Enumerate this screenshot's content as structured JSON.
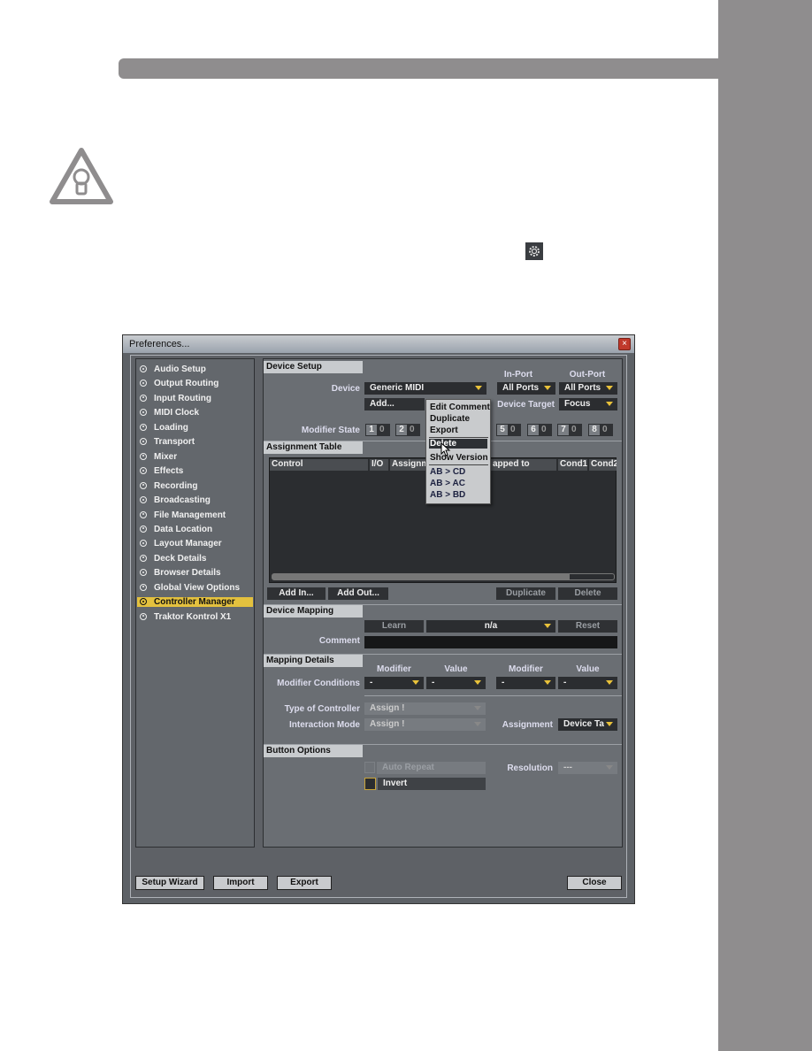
{
  "page": {
    "tip_icon": "lightbulb-warning-icon",
    "gear_icon": "gear-icon"
  },
  "dialog": {
    "title": "Preferences...",
    "nav": [
      "Audio Setup",
      "Output Routing",
      "Input Routing",
      "MIDI Clock",
      "Loading",
      "Transport",
      "Mixer",
      "Effects",
      "Recording",
      "Broadcasting",
      "File Management",
      "Data Location",
      "Layout Manager",
      "Deck Details",
      "Browser Details",
      "Global View Options",
      "Controller Manager",
      "Traktor Kontrol X1"
    ],
    "selected_nav": "Controller Manager",
    "device_setup": {
      "title": "Device Setup",
      "device_label": "Device",
      "device_value": "Generic MIDI",
      "in_port_label": "In-Port",
      "in_port_value": "All Ports",
      "out_port_label": "Out-Port",
      "out_port_value": "All Ports",
      "add_label": "Add...",
      "device_target_label": "Device Target",
      "device_target_value": "Focus",
      "modifier_state_label": "Modifier State",
      "modifiers": [
        {
          "n": "1",
          "v": "0"
        },
        {
          "n": "2",
          "v": "0"
        },
        {
          "n": "5",
          "v": "0"
        },
        {
          "n": "6",
          "v": "0"
        },
        {
          "n": "7",
          "v": "0"
        },
        {
          "n": "8",
          "v": "0"
        }
      ]
    },
    "context_menu": {
      "items": [
        "Edit Comment",
        "Duplicate",
        "Export",
        "Delete",
        "Show Version",
        "AB > CD",
        "AB > AC",
        "AB > BD"
      ],
      "highlighted": "Delete"
    },
    "assignment_table": {
      "title": "Assignment Table",
      "columns": [
        "Control",
        "I/O",
        "Assignm",
        "apped to",
        "Cond1",
        "Cond2"
      ],
      "add_in": "Add In...",
      "add_out": "Add Out...",
      "duplicate": "Duplicate",
      "delete": "Delete"
    },
    "device_mapping": {
      "title": "Device Mapping",
      "learn": "Learn",
      "value": "n/a",
      "reset": "Reset",
      "comment_label": "Comment",
      "comment_value": ""
    },
    "mapping_details": {
      "title": "Mapping Details",
      "modifier_h1": "Modifier",
      "value_h1": "Value",
      "modifier_h2": "Modifier",
      "value_h2": "Value",
      "conditions_label": "Modifier Conditions",
      "conditions": [
        "-",
        "-",
        "-",
        "-"
      ],
      "type_label": "Type of Controller",
      "type_value": "Assign !",
      "interaction_label": "Interaction Mode",
      "interaction_value": "Assign !",
      "assignment_label": "Assignment",
      "assignment_value": "Device Ta"
    },
    "button_options": {
      "title": "Button Options",
      "auto_repeat": "Auto Repeat",
      "invert": "Invert",
      "resolution_label": "Resolution",
      "resolution_value": "---"
    },
    "footer": {
      "setup_wizard": "Setup Wizard",
      "import": "Import",
      "export": "Export",
      "close": "Close"
    }
  },
  "colors": {
    "accent": "#e4c13e",
    "page_gray": "#8f8d8e"
  }
}
